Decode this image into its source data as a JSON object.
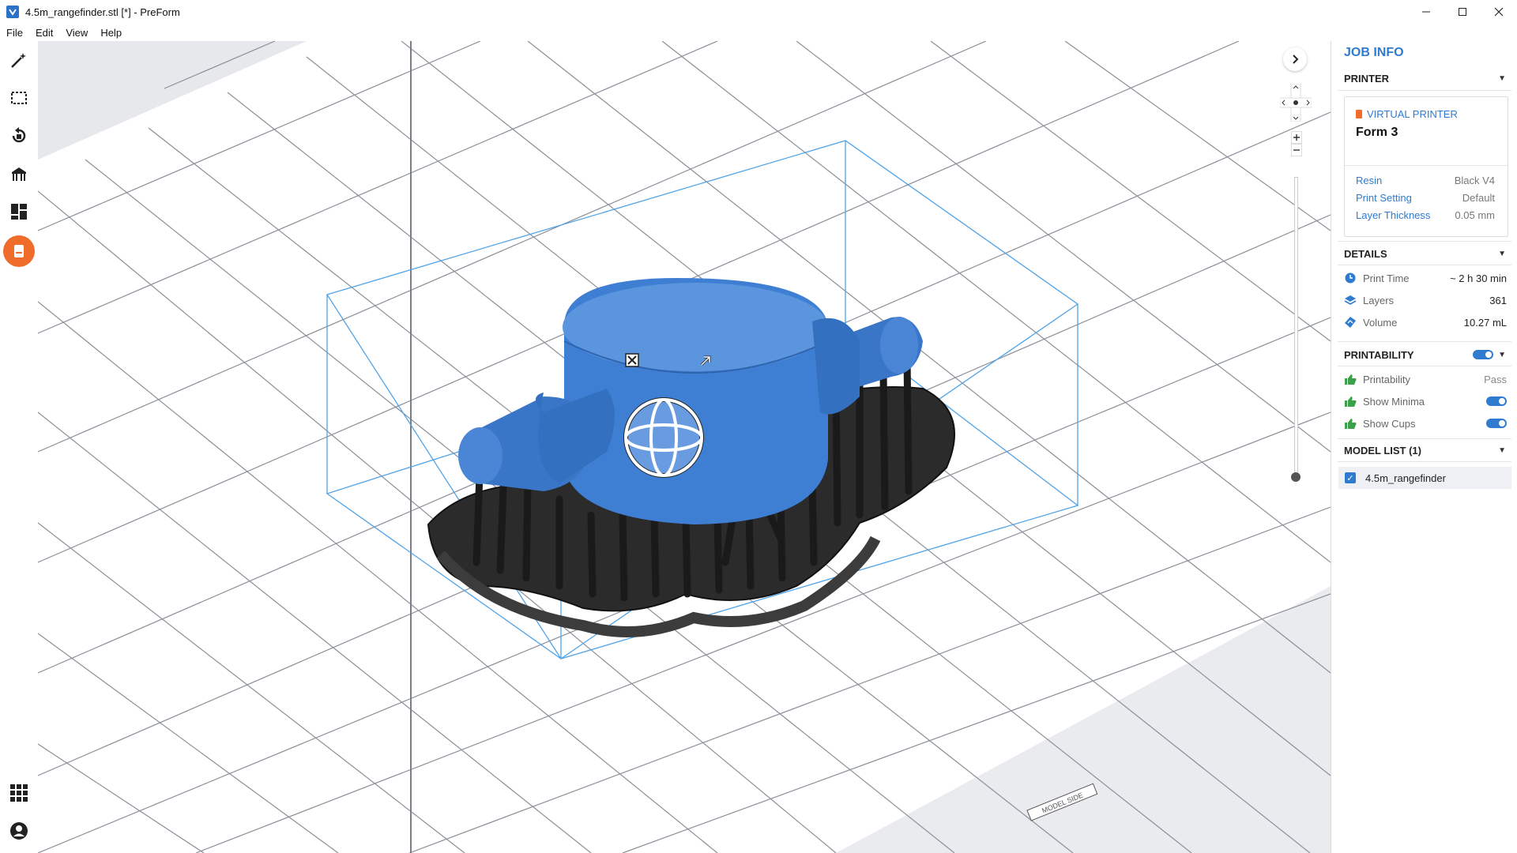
{
  "window": {
    "title": "4.5m_rangefinder.stl [*] - PreForm",
    "controls": [
      "minimize-icon",
      "maximize-icon",
      "close-icon"
    ]
  },
  "menu": [
    "File",
    "Edit",
    "View",
    "Help"
  ],
  "toolbar": {
    "tools": [
      "magic-wand-icon",
      "select-box-icon",
      "orientation-icon",
      "supports-icon",
      "layout-icon",
      "printer-icon"
    ],
    "bottom": [
      "apps-grid-icon",
      "account-icon"
    ],
    "accent": "#ef6c2b"
  },
  "job_info": {
    "title": "JOB INFO",
    "printer": {
      "heading": "PRINTER",
      "type_label": "VIRTUAL PRINTER",
      "model": "Form 3",
      "rows": [
        {
          "key": "Resin",
          "value": "Black V4"
        },
        {
          "key": "Print Setting",
          "value": "Default"
        },
        {
          "key": "Layer Thickness",
          "value": "0.05 mm"
        }
      ]
    },
    "details": {
      "heading": "DETAILS",
      "rows": [
        {
          "icon": "clock-icon",
          "label": "Print Time",
          "value": "~ 2 h 30 min"
        },
        {
          "icon": "layers-icon",
          "label": "Layers",
          "value": "361"
        },
        {
          "icon": "volume-icon",
          "label": "Volume",
          "value": "10.27 mL"
        }
      ]
    },
    "printability": {
      "heading": "PRINTABILITY",
      "rows": [
        {
          "label": "Printability",
          "value": "Pass"
        },
        {
          "label": "Show Minima",
          "toggle": true
        },
        {
          "label": "Show Cups",
          "toggle": true
        }
      ]
    },
    "model_list": {
      "heading": "MODEL LIST (1)",
      "items": [
        "4.5m_rangefinder"
      ]
    }
  },
  "viewport": {
    "plate_label": "MODEL SIDE",
    "colors": {
      "model": "#3f7fd3",
      "supports": "#2b2b2b",
      "bounding_box": "#4fa3e8",
      "grid": "#8a8f98"
    }
  }
}
